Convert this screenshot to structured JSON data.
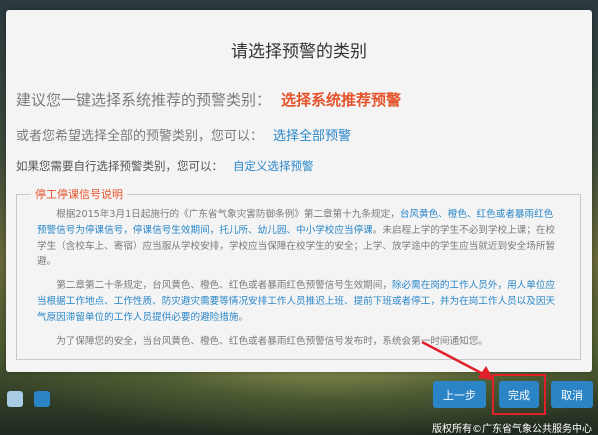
{
  "dialog": {
    "title": "请选择预警的类别",
    "row1_text": "建议您一键选择系统推荐的预警类别：",
    "row1_link": "选择系统推荐预警",
    "row2_text": "或者您希望选择全部的预警类别，您可以：",
    "row2_link": "选择全部预警",
    "row3_text": "如果您需要自行选择预警类别，您可以：",
    "row3_link": "自定义选择预警",
    "legend": "停工停课信号说明",
    "p1_a": "根据2015年3月1日起施行的《广东省气象灾害防御条例》第二章第十九条规定，",
    "p1_b": "台风黄色、橙色、红色或者暴雨红色预警信号为停课信号，停课信号生效期间，托儿所、幼儿园、中小学校应当停课",
    "p1_c": "。未启程上学的学生不必到学校上课；在校学生（含校车上、寄宿）应当服从学校安排，学校应当保障在校学生的安全；上学、放学途中的学生应当就近到安全场所暂避。",
    "p2_a": "第二章第二十条规定，台风黄色、橙色、红色或者暴雨红色预警信号生效期间，",
    "p2_b": "除必需在岗的工作人员外，用人单位应当根据工作地点、工作性质、防灾避灾需要等情况安排工作人员推迟上班、提前下班或者停工，并为在岗工作人员以及因天气原因滞留单位的工作人员提供必要的避险措施",
    "p2_c": "。",
    "p3": "为了保障您的安全，当台风黄色、橙色、红色或者暴雨红色预警信号发布时，系统会第一时间通知您。"
  },
  "footer": {
    "prev_label": "上一步",
    "done_label": "完成",
    "cancel_label": "取消",
    "copyright": "版权所有©广东省气象公共服务中心"
  },
  "colors": {
    "accent": "#2a84c6",
    "highlight": "#e5542c",
    "annotation": "#e0202a"
  }
}
